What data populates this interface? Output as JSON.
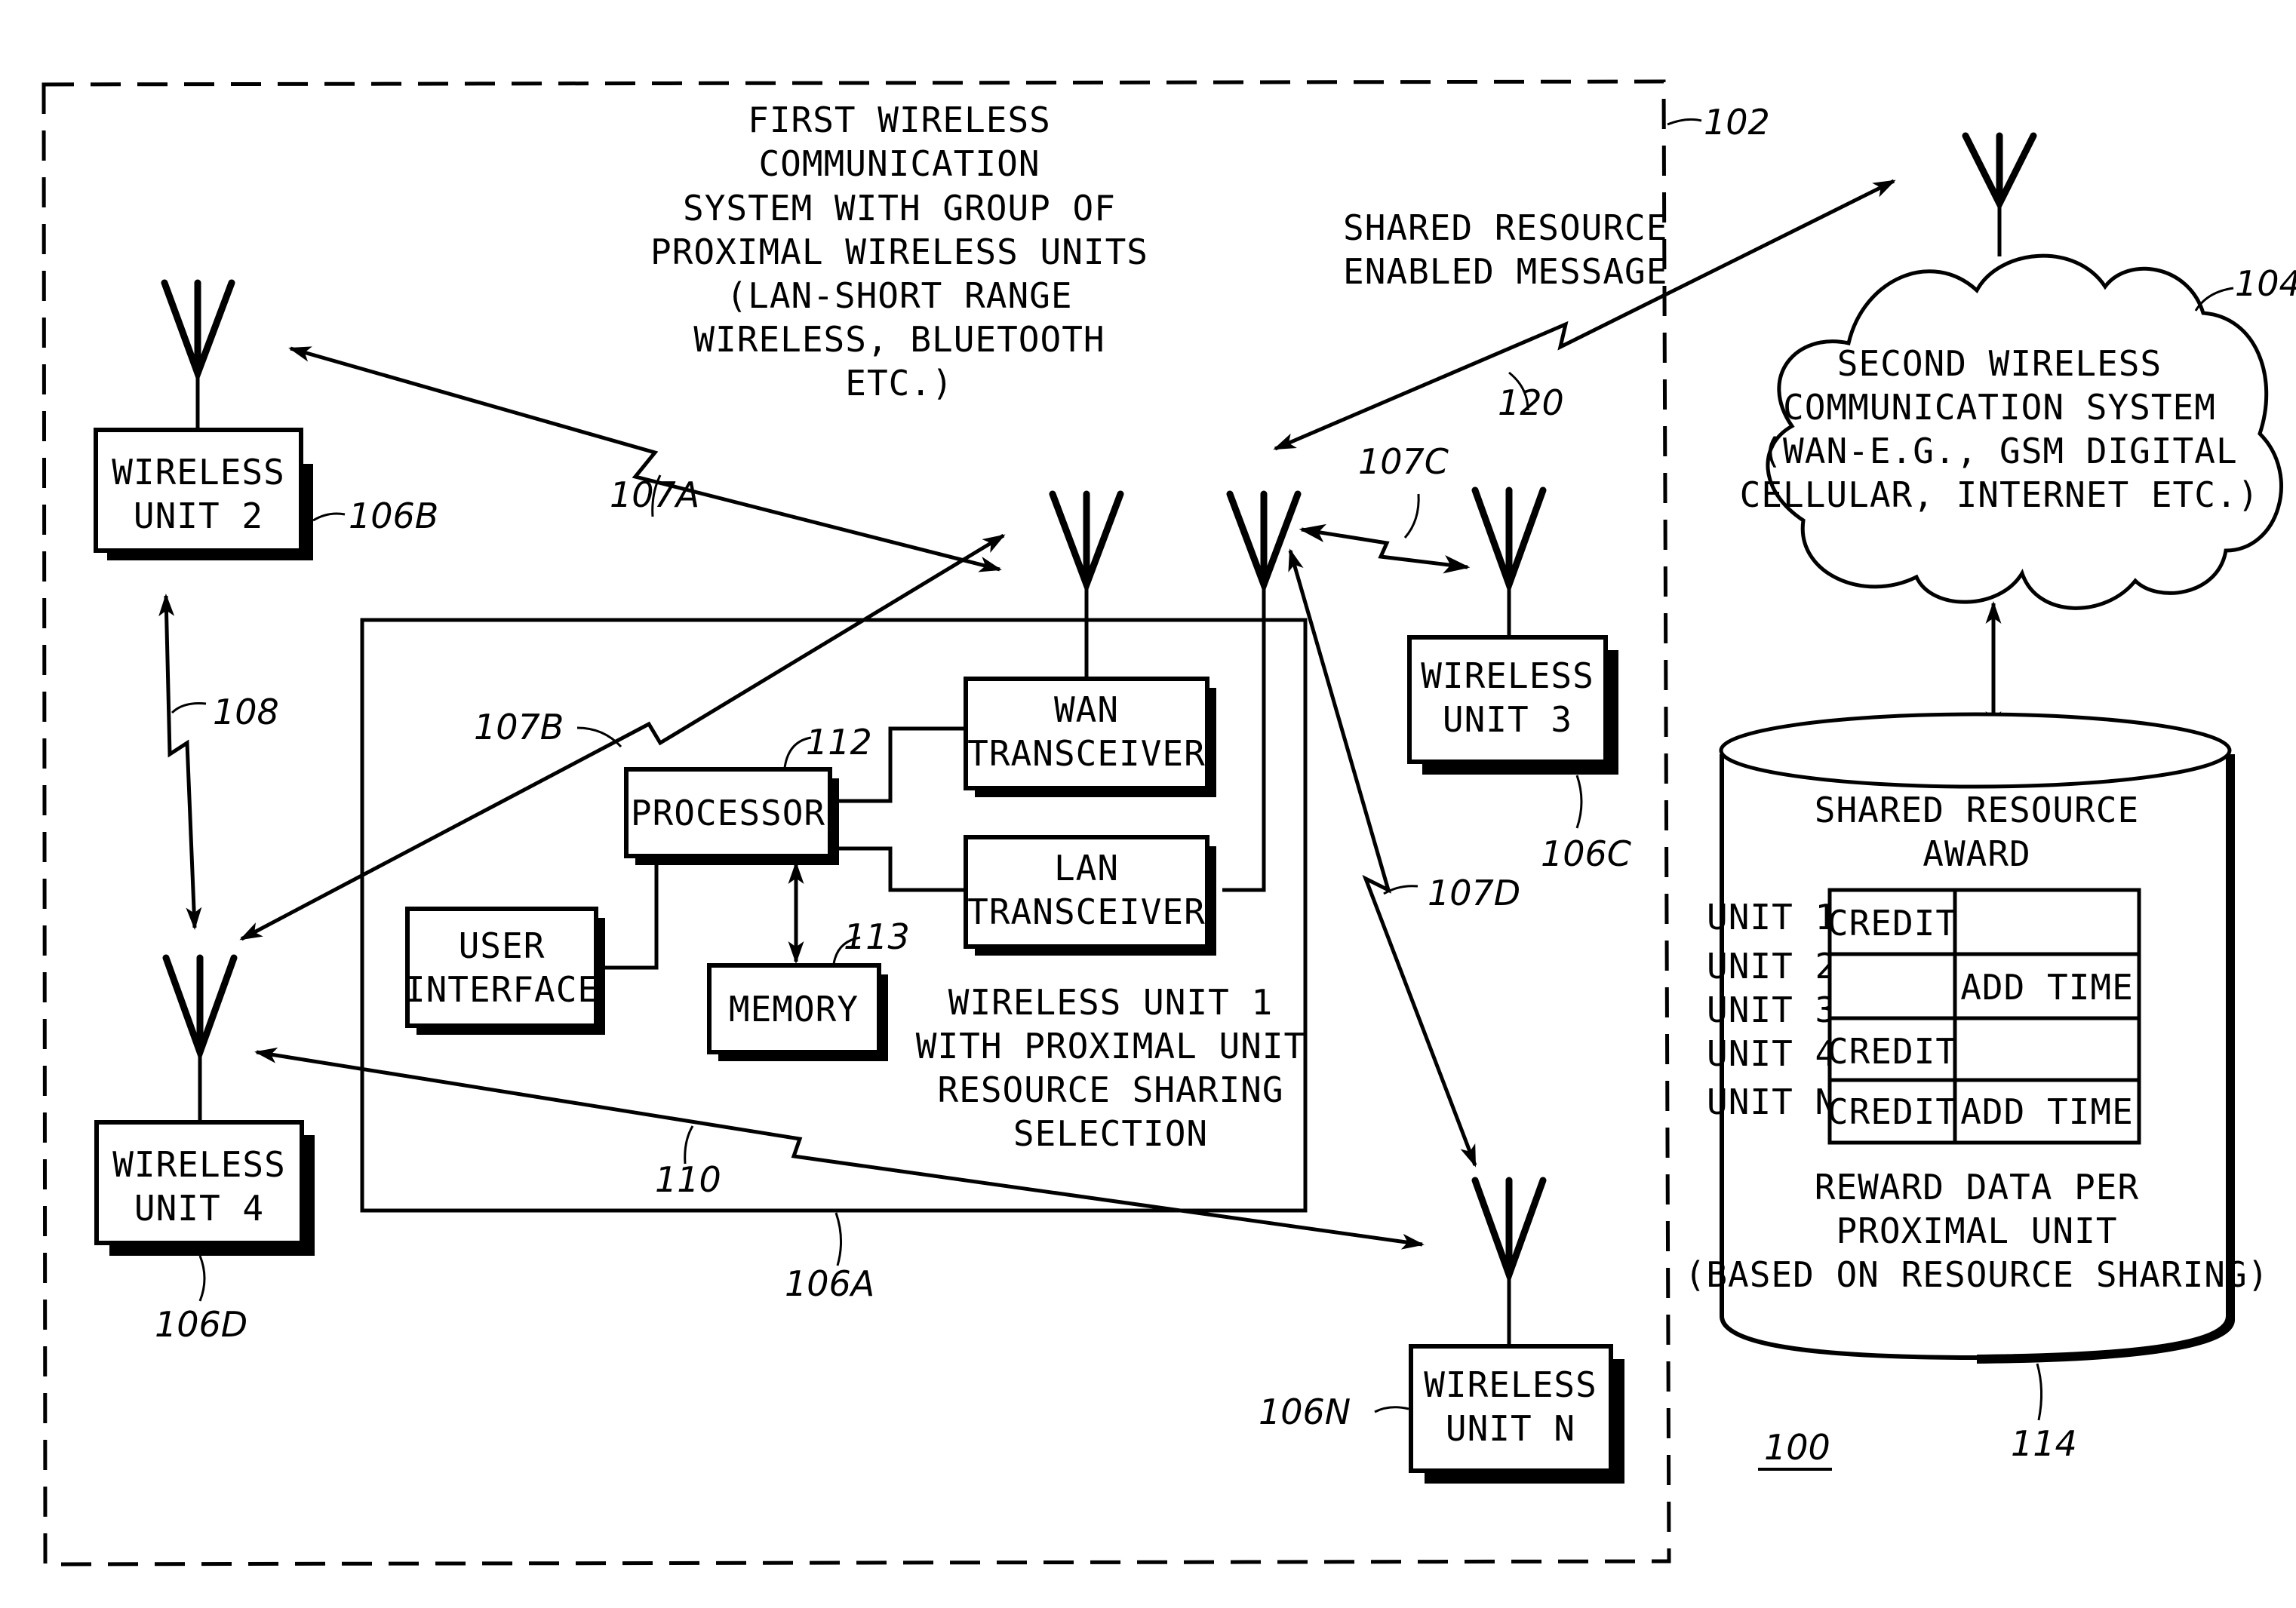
{
  "figure": {
    "ref_number": "100",
    "first_system": {
      "ref": "102",
      "title_lines": [
        "FIRST WIRELESS",
        "COMMUNICATION",
        "SYSTEM WITH GROUP OF",
        "PROXIMAL WIRELESS UNITS",
        "(LAN-SHORT RANGE",
        "WIRELESS, BLUETOOTH",
        "ETC.)"
      ]
    },
    "shared_message": {
      "lines": [
        "SHARED RESOURCE",
        "ENABLED MESSAGE"
      ],
      "ref": "120"
    },
    "second_system": {
      "ref": "104",
      "lines": [
        "SECOND WIRELESS",
        "COMMUNICATION SYSTEM",
        "(WAN-E.G., GSM DIGITAL",
        "CELLULAR, INTERNET ETC.)"
      ]
    },
    "units": {
      "unit1": {
        "ref": "106A",
        "caption_lines": [
          "WIRELESS UNIT 1",
          "WITH PROXIMAL UNIT",
          "RESOURCE SHARING",
          "SELECTION"
        ],
        "processor": {
          "label": "PROCESSOR",
          "ref": "112"
        },
        "memory": {
          "label": "MEMORY",
          "ref": "113"
        },
        "user_interface": {
          "lines": [
            "USER",
            "INTERFACE"
          ]
        },
        "wan_transceiver": {
          "lines": [
            "WAN",
            "TRANSCEIVER"
          ]
        },
        "lan_transceiver": {
          "lines": [
            "LAN",
            "TRANSCEIVER"
          ]
        }
      },
      "unit2": {
        "lines": [
          "WIRELESS",
          "UNIT 2"
        ],
        "ref": "106B"
      },
      "unit3": {
        "lines": [
          "WIRELESS",
          "UNIT 3"
        ],
        "ref": "106C"
      },
      "unit4": {
        "lines": [
          "WIRELESS",
          "UNIT 4"
        ],
        "ref": "106D"
      },
      "unitN": {
        "lines": [
          "WIRELESS",
          "UNIT N"
        ],
        "ref": "106N"
      }
    },
    "links": {
      "l107A": "107A",
      "l107B": "107B",
      "l107C": "107C",
      "l107D": "107D",
      "l108": "108",
      "l110": "110"
    },
    "database": {
      "ref": "114",
      "title_lines": [
        "SHARED RESOURCE",
        "AWARD"
      ],
      "row_labels": [
        "UNIT 1",
        "UNIT 2",
        "UNIT 3",
        "UNIT 4",
        "UNIT N"
      ],
      "table": [
        [
          "CREDIT",
          ""
        ],
        [
          "",
          "ADD TIME"
        ],
        [
          "CREDIT",
          ""
        ],
        [
          "CREDIT",
          "ADD TIME"
        ]
      ],
      "footer_lines": [
        "REWARD DATA PER",
        "PROXIMAL UNIT",
        "(BASED ON RESOURCE SHARING)"
      ]
    }
  }
}
